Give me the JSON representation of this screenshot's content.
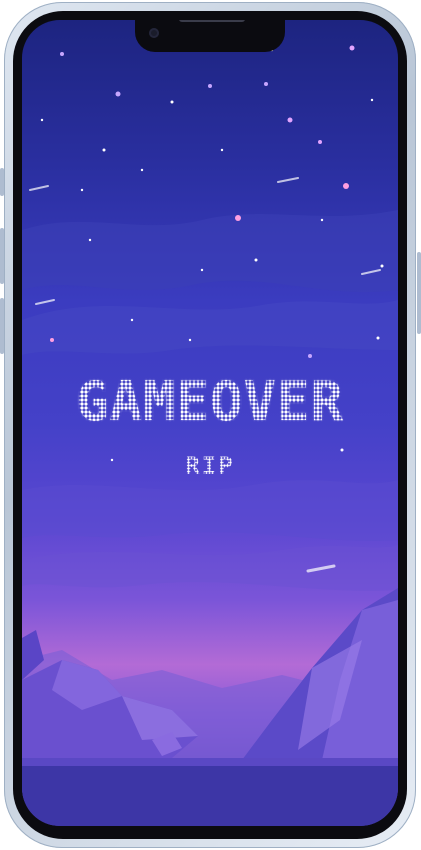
{
  "screen": {
    "title": "GAMEOVER",
    "subtitle": "RIP"
  },
  "colors": {
    "sky_top": "#1d2480",
    "sky_mid": "#4441c8",
    "horizon_glow": "#b36bd6",
    "text": "#ffffff",
    "phone_frame": "#b9c6d6"
  }
}
